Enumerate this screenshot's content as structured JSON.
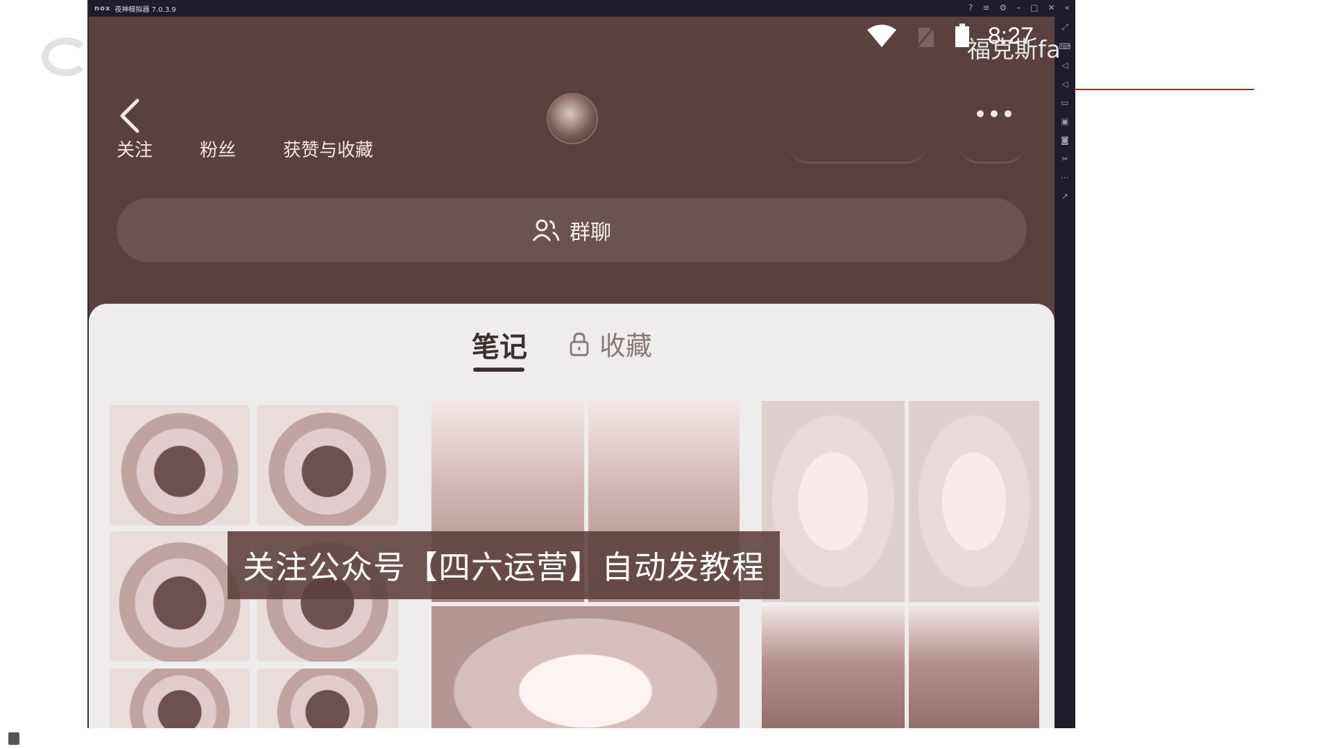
{
  "emulator": {
    "logo": "nox",
    "title": "夜神模拟器 7.0.3.9"
  },
  "status_bar": {
    "time": "8:27",
    "overlay_text": "福克斯fa"
  },
  "profile": {
    "stats": [
      "关注",
      "粉丝",
      "获赞与收藏"
    ],
    "group_chat_label": "群聊"
  },
  "tabs": {
    "notes": "笔记",
    "collections": "收藏"
  },
  "overlay": {
    "watermark": "关注公众号【四六运营】自动发教程"
  },
  "colors": {
    "header_bg": "#58413f",
    "content_bg": "#eeecec",
    "emulator_chrome": "#1f1c2c"
  },
  "icons": {
    "back": "chevron-left-icon",
    "more": "more-dots-icon",
    "group": "group-icon",
    "lock": "lock-icon",
    "wifi": "wifi-icon",
    "signal": "no-sim-icon",
    "battery": "battery-icon"
  }
}
